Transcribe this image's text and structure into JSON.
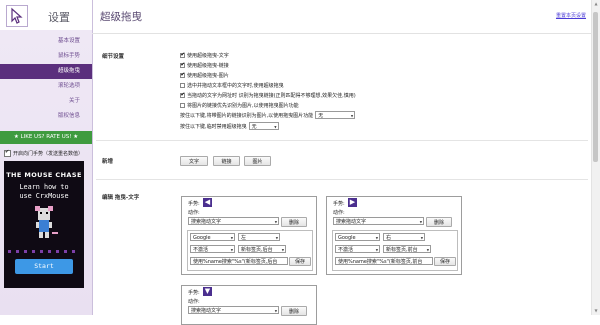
{
  "sidebar": {
    "title": "设置",
    "nav": [
      {
        "label": "基本设置",
        "active": false
      },
      {
        "label": "鼠标手势",
        "active": false
      },
      {
        "label": "超级拖曳",
        "active": true
      },
      {
        "label": "滚轮选项",
        "active": false
      },
      {
        "label": "关于",
        "active": false
      },
      {
        "label": "版权信息",
        "active": false
      }
    ],
    "rate": "★ LIKE US? RATE US! ★",
    "toggle_label": "开启向门手势（发送重名数值）",
    "ad": {
      "title": "THE MOUSE CHASE",
      "line1": "Learn how to",
      "line2": "use CrxMouse",
      "start": "Start"
    }
  },
  "header": {
    "title": "超级拖曳",
    "restore": "重置本页设置"
  },
  "details": {
    "label": "细节设置",
    "options": [
      {
        "label": "使用超级拖曳-文字",
        "checked": true
      },
      {
        "label": "使用超级拖曳-链接",
        "checked": true
      },
      {
        "label": "使用超级拖曳-图片",
        "checked": true
      },
      {
        "label": "选中并拖动文本框中的文字时,使用超级拖曳",
        "checked": false
      },
      {
        "label": "当拖动的文字为网址时 识别为拖曳链接(正则匹配得不够理想,效果欠佳,慎用)",
        "checked": true
      },
      {
        "label": "将图片的链接优先识别为图片,以使用拖曳图片功能",
        "checked": false
      }
    ],
    "key_row1": {
      "label": "按住以下键,将带图片的链接识别为图片,以使用拖曳图片功能",
      "value": "无"
    },
    "key_row2": {
      "label": "按住以下键,临时禁用超级拖曳",
      "value": "无"
    }
  },
  "new": {
    "label": "新增",
    "buttons": [
      "文字",
      "链接",
      "图片"
    ]
  },
  "edit": {
    "label": "编辑 拖曳-文字",
    "gesture_label": "手势:",
    "action_label": "动作:",
    "delete": "删除",
    "save": "保存",
    "cards": [
      {
        "arrow": "◀",
        "action": "搜索拖动文字",
        "engine": "Google",
        "pos": "左",
        "mode": "不激活",
        "tab": "新标签页,后台",
        "url": "使用%name搜索\"%s\"(新标签页,后台"
      },
      {
        "arrow": "▶",
        "action": "搜索拖动文字",
        "engine": "Google",
        "pos": "右",
        "mode": "不激活",
        "tab": "新标签页,前台",
        "url": "使用%name搜索\"%s\"(新标签页,前台"
      },
      {
        "arrow": "▼",
        "action": "搜索拖动文字"
      }
    ]
  },
  "colors": {
    "accent": "#5b2f7d",
    "rate": "#3f9b3f",
    "link": "#4a3ad6"
  }
}
